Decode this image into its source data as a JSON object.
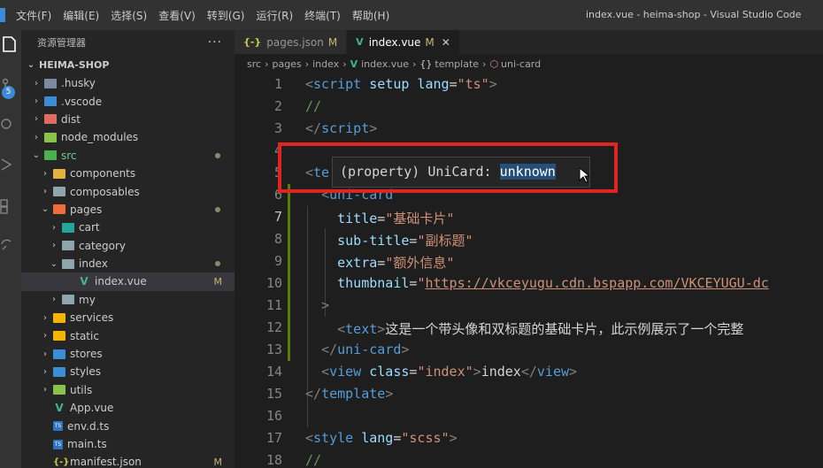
{
  "menu": [
    "文件(F)",
    "编辑(E)",
    "选择(S)",
    "查看(V)",
    "转到(G)",
    "运行(R)",
    "终端(T)",
    "帮助(H)"
  ],
  "window_title": "index.vue - heima-shop - Visual Studio Code",
  "activity": {
    "scm_badge": "5"
  },
  "sidebar": {
    "title": "资源管理器",
    "more": "···",
    "root": "HEIMA-SHOP",
    "items": [
      {
        "label": ".husky",
        "kind": "folder",
        "color": "#7a8aa0",
        "indent": 0,
        "chev": "›"
      },
      {
        "label": ".vscode",
        "kind": "folder",
        "color": "#3b8ed6",
        "indent": 0,
        "chev": "›"
      },
      {
        "label": "dist",
        "kind": "folder",
        "color": "#e06c5f",
        "indent": 0,
        "chev": "›"
      },
      {
        "label": "node_modules",
        "kind": "folder",
        "color": "#8bc34a",
        "indent": 0,
        "chev": "›"
      },
      {
        "label": "src",
        "kind": "folder",
        "color": "#4caf50",
        "indent": 0,
        "chev": "⌄",
        "dot": true,
        "green": true
      },
      {
        "label": "components",
        "kind": "folder",
        "color": "#e0b341",
        "indent": 1,
        "chev": "›"
      },
      {
        "label": "composables",
        "kind": "folder",
        "color": "#90a4ae",
        "indent": 1,
        "chev": "›"
      },
      {
        "label": "pages",
        "kind": "folder",
        "color": "#ef6c3a",
        "indent": 1,
        "chev": "⌄",
        "dot": true
      },
      {
        "label": "cart",
        "kind": "folder",
        "color": "#26a69a",
        "indent": 2,
        "chev": "›"
      },
      {
        "label": "category",
        "kind": "folder",
        "color": "#90a4ae",
        "indent": 2,
        "chev": "›"
      },
      {
        "label": "index",
        "kind": "folder",
        "color": "#90a4ae",
        "indent": 2,
        "chev": "⌄",
        "dot": true
      },
      {
        "label": "index.vue",
        "kind": "vue",
        "indent": 3,
        "chev": "",
        "badge": "M",
        "selected": true
      },
      {
        "label": "my",
        "kind": "folder",
        "color": "#90a4ae",
        "indent": 2,
        "chev": "›"
      },
      {
        "label": "services",
        "kind": "folder",
        "color": "#f4b400",
        "indent": 1,
        "chev": "›"
      },
      {
        "label": "static",
        "kind": "folder",
        "color": "#f4b400",
        "indent": 1,
        "chev": "›"
      },
      {
        "label": "stores",
        "kind": "folder",
        "color": "#3b8ed6",
        "indent": 1,
        "chev": "›"
      },
      {
        "label": "styles",
        "kind": "folder",
        "color": "#3b8ed6",
        "indent": 1,
        "chev": "›"
      },
      {
        "label": "utils",
        "kind": "folder",
        "color": "#8bc34a",
        "indent": 1,
        "chev": "›"
      },
      {
        "label": "App.vue",
        "kind": "vue",
        "indent": 1,
        "chev": ""
      },
      {
        "label": "env.d.ts",
        "kind": "ts",
        "indent": 1,
        "chev": ""
      },
      {
        "label": "main.ts",
        "kind": "ts",
        "indent": 1,
        "chev": ""
      },
      {
        "label": "manifest.json",
        "kind": "json",
        "indent": 1,
        "chev": "",
        "badge": "M"
      }
    ]
  },
  "tabs": [
    {
      "icon": "{-}",
      "label": "pages.json",
      "mod": "M",
      "active": false
    },
    {
      "icon": "V",
      "label": "index.vue",
      "mod": "M",
      "active": true,
      "close": "✕"
    }
  ],
  "breadcrumb": {
    "parts": [
      "src",
      "pages",
      "index"
    ],
    "file": "index.vue",
    "node1": "template",
    "node2": "uni-card"
  },
  "code_lines": [
    {
      "n": "1",
      "html": "<span class='punct'>&lt;</span><span class='tag'>script</span> <span class='attr'>setup</span> <span class='attr'>lang</span><span class='txt'>=</span><span class='str'>\"ts\"</span><span class='punct'>&gt;</span>"
    },
    {
      "n": "2",
      "html": "<span class='comment'>//</span>"
    },
    {
      "n": "3",
      "html": "<span class='punct'>&lt;/</span><span class='tag'>script</span><span class='punct'>&gt;</span>"
    },
    {
      "n": "4",
      "html": ""
    },
    {
      "n": "5",
      "html": "<span class='punct'>&lt;</span><span class='tag'>te</span>"
    },
    {
      "n": "6",
      "html": "  <span class='punct'>&lt;</span><span class='tag'>uni-card</span>"
    },
    {
      "n": "7",
      "html": "    <span class='attr'>title</span><span class='txt'>=</span><span class='str'>\"基础卡片\"</span>",
      "current": true
    },
    {
      "n": "8",
      "html": "    <span class='attr'>sub-title</span><span class='txt'>=</span><span class='str'>\"副标题\"</span>"
    },
    {
      "n": "9",
      "html": "    <span class='attr'>extra</span><span class='txt'>=</span><span class='str'>\"额外信息\"</span>"
    },
    {
      "n": "10",
      "html": "    <span class='attr'>thumbnail</span><span class='txt'>=</span><span class='str'>\"</span><span class='url'>https://vkceyugu.cdn.bspapp.com/VKCEYUGU-dc</span>"
    },
    {
      "n": "11",
      "html": "  <span class='punct'>&gt;</span>"
    },
    {
      "n": "12",
      "html": "    <span class='punct'>&lt;</span><span class='tag'>text</span><span class='punct'>&gt;</span><span class='txt'>这是一个带头像和双标题的基础卡片，此示例展示了一个完整</span>"
    },
    {
      "n": "13",
      "html": "  <span class='punct'>&lt;/</span><span class='tag'>uni-card</span><span class='punct'>&gt;</span>"
    },
    {
      "n": "14",
      "html": "  <span class='punct'>&lt;</span><span class='tag'>view</span> <span class='attr'>class</span><span class='txt'>=</span><span class='str'>\"index\"</span><span class='punct'>&gt;</span><span class='txt'>index</span><span class='punct'>&lt;/</span><span class='tag'>view</span><span class='punct'>&gt;</span>"
    },
    {
      "n": "15",
      "html": "<span class='punct'>&lt;/</span><span class='tag'>template</span><span class='punct'>&gt;</span>"
    },
    {
      "n": "16",
      "html": ""
    },
    {
      "n": "17",
      "html": "<span class='punct'>&lt;</span><span class='tag'>style</span> <span class='attr'>lang</span><span class='txt'>=</span><span class='str'>\"scss\"</span><span class='punct'>&gt;</span>"
    },
    {
      "n": "18",
      "html": "<span class='comment'>//</span>"
    }
  ],
  "hover": {
    "prefix": "(property) UniCard: ",
    "type": "unknown"
  }
}
